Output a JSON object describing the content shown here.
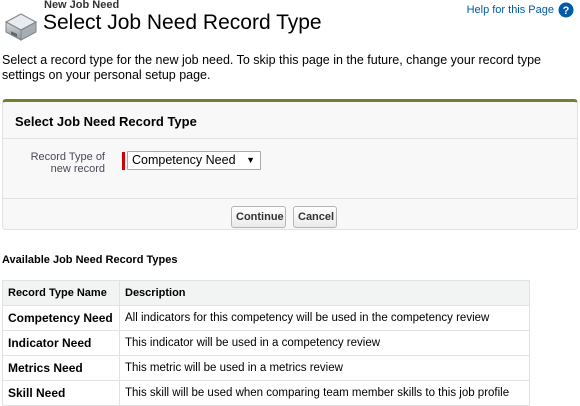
{
  "header": {
    "subtitle": "New Job Need",
    "title": "Select Job Need Record Type",
    "help_link": "Help for this Page"
  },
  "intro": "Select a record type for the new job need. To skip this page in the future, change your record type settings on your personal setup page.",
  "panel": {
    "title": "Select Job Need Record Type",
    "record_type_label": "Record Type of new record",
    "selected_record_type": "Competency Need",
    "continue_label": "Continue",
    "cancel_label": "Cancel"
  },
  "available": {
    "title": "Available Job Need Record Types",
    "columns": [
      "Record Type Name",
      "Description"
    ],
    "rows": [
      {
        "name": "Competency Need",
        "description": "All indicators for this competency will be used in the competency review"
      },
      {
        "name": "Indicator Need",
        "description": "This indicator will be used in a competency review"
      },
      {
        "name": "Metrics Need",
        "description": "This metric will be used in a metrics review"
      },
      {
        "name": "Skill Need",
        "description": "This skill will be used when comparing team member skills to this job profile"
      }
    ]
  },
  "colors": {
    "accent_bar": "#747e2d",
    "link": "#015ba7",
    "required": "#cc0000"
  },
  "icons": {
    "header": "job-need-drawer-icon",
    "help": "help-question-icon",
    "select": "chevron-down-icon"
  }
}
